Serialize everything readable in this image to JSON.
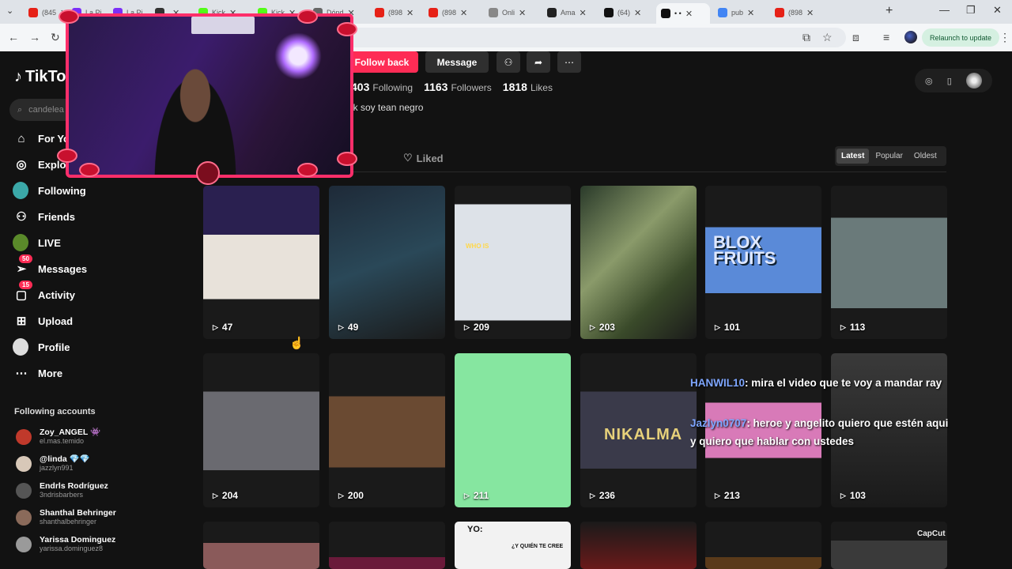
{
  "browser": {
    "tabs": [
      {
        "label": "(845",
        "color": "#e62117"
      },
      {
        "label": "La Pi",
        "color": "#7b2ff7"
      },
      {
        "label": "La Pi",
        "color": "#7b2ff7"
      },
      {
        "label": "",
        "color": "#333333"
      },
      {
        "label": "Kick",
        "color": "#53fc18"
      },
      {
        "label": "Kick",
        "color": "#53fc18"
      },
      {
        "label": "Dónd",
        "color": "#666666"
      },
      {
        "label": "(898",
        "color": "#e62117"
      },
      {
        "label": "(898",
        "color": "#e62117"
      },
      {
        "label": "Onli",
        "color": "#888888"
      },
      {
        "label": "Ama",
        "color": "#222222"
      },
      {
        "label": "(64)",
        "color": "#111111"
      },
      {
        "label": "• •",
        "color": "#111111"
      },
      {
        "label": "pub",
        "color": "#4285f4"
      },
      {
        "label": "(898",
        "color": "#e62117"
      }
    ],
    "relaunch_label": "Relaunch to update"
  },
  "nav": {
    "logo": "TikTok",
    "search_placeholder": "candelea",
    "items": [
      {
        "label": "For You",
        "icon": "home-icon"
      },
      {
        "label": "Explore",
        "icon": "compass-icon"
      },
      {
        "label": "Following",
        "icon": "following-avatar"
      },
      {
        "label": "Friends",
        "icon": "friends-icon"
      },
      {
        "label": "LIVE",
        "icon": "live-avatar"
      },
      {
        "label": "Messages",
        "icon": "messages-icon",
        "badge": "50"
      },
      {
        "label": "Activity",
        "icon": "activity-icon",
        "badge": "15"
      },
      {
        "label": "Upload",
        "icon": "upload-icon"
      },
      {
        "label": "Profile",
        "icon": "profile-avatar"
      },
      {
        "label": "More",
        "icon": "more-icon"
      }
    ],
    "following_title": "Following accounts",
    "accounts": [
      {
        "name": "Zoy_ANGEL 👾",
        "handle": "el.mas.temido",
        "color": "#c0392b"
      },
      {
        "name": "@linda 💎💎",
        "handle": "jazzlyn991",
        "color": "#d8c8b8"
      },
      {
        "name": "Endrls Rodríguez",
        "handle": "3ndrisbarbers",
        "color": "#555555"
      },
      {
        "name": "Shanthal Behringer",
        "handle": "shanthalbehringer",
        "color": "#8a6a5a"
      },
      {
        "name": "Yarissa Dominguez",
        "handle": "yarissa.dominguez8",
        "color": "#9a9a9a"
      }
    ]
  },
  "profile": {
    "follow_back": "Follow back",
    "message": "Message",
    "stats": [
      {
        "value": "403",
        "label": "Following"
      },
      {
        "value": "1163",
        "label": "Followers"
      },
      {
        "value": "1818",
        "label": "Likes"
      }
    ],
    "bio": "lk soy tean negro",
    "tab_videos": "s",
    "tab_liked": "Liked",
    "sort": [
      "Latest",
      "Popular",
      "Oldest"
    ]
  },
  "videos": [
    {
      "views": "47"
    },
    {
      "views": "49"
    },
    {
      "views": "209",
      "text": "WHO IS"
    },
    {
      "views": "203"
    },
    {
      "views": "101",
      "text": "BLOX FRUITS"
    },
    {
      "views": "113"
    },
    {
      "views": "204"
    },
    {
      "views": "200"
    },
    {
      "views": "211"
    },
    {
      "views": "236",
      "text": "NIKALMA"
    },
    {
      "views": "213"
    },
    {
      "views": "103"
    },
    {
      "views": ""
    },
    {
      "views": ""
    },
    {
      "views": "",
      "text": "YO:"
    },
    {
      "views": ""
    },
    {
      "views": ""
    },
    {
      "views": ""
    }
  ],
  "overlay": {
    "chat": [
      {
        "user": "HANWIL10",
        "text": ": mira el video que te voy a mandar ray"
      },
      {
        "user": "Jazlyn0707",
        "text": ": heroe y angelito quiero que estén aqui y quiero que hablar con ustedes"
      }
    ],
    "thumb_caption": "¿Y QUIÉN TE CREE",
    "watermark": "CapCut"
  }
}
